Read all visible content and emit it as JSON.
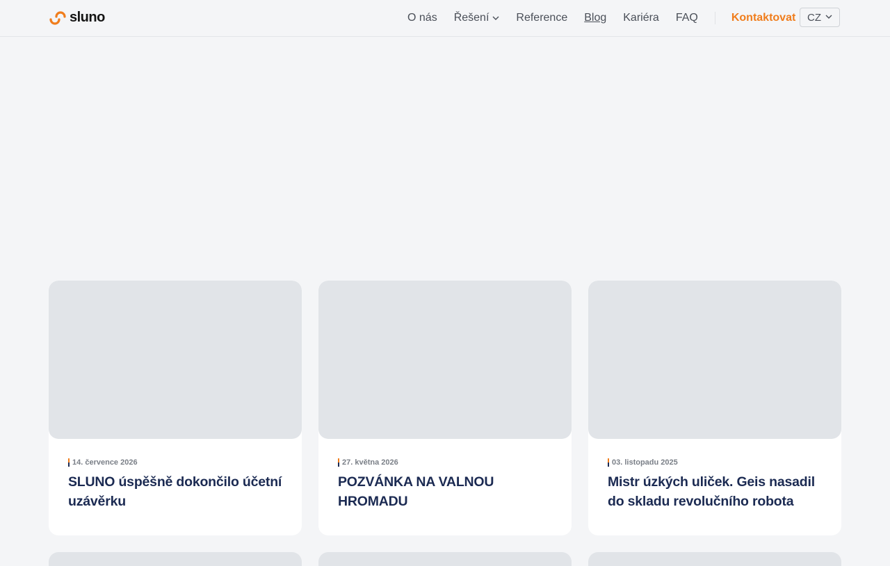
{
  "header": {
    "logo_text": "sluno",
    "nav": [
      {
        "label": "O nás"
      },
      {
        "label": "Řešení"
      },
      {
        "label": "Reference"
      },
      {
        "label": "Blog"
      },
      {
        "label": "Kariéra"
      },
      {
        "label": "FAQ"
      }
    ],
    "contact_label": "Kontaktovat",
    "language": "CZ"
  },
  "posts": [
    {
      "date": "14. července 2026",
      "title": "SLUNO úspěšně dokončilo účetní uzávěrku"
    },
    {
      "date": "27. května 2026",
      "title": "POZVÁNKA NA VALNOU HROMADU"
    },
    {
      "date": "03. listopadu 2025",
      "title": "Mistr úzkých uliček. Geis nasadil do skladu revolučního robota"
    }
  ],
  "colors": {
    "accent": "#f07d1c",
    "title": "#1b2a52",
    "background": "#f4f5f7"
  }
}
